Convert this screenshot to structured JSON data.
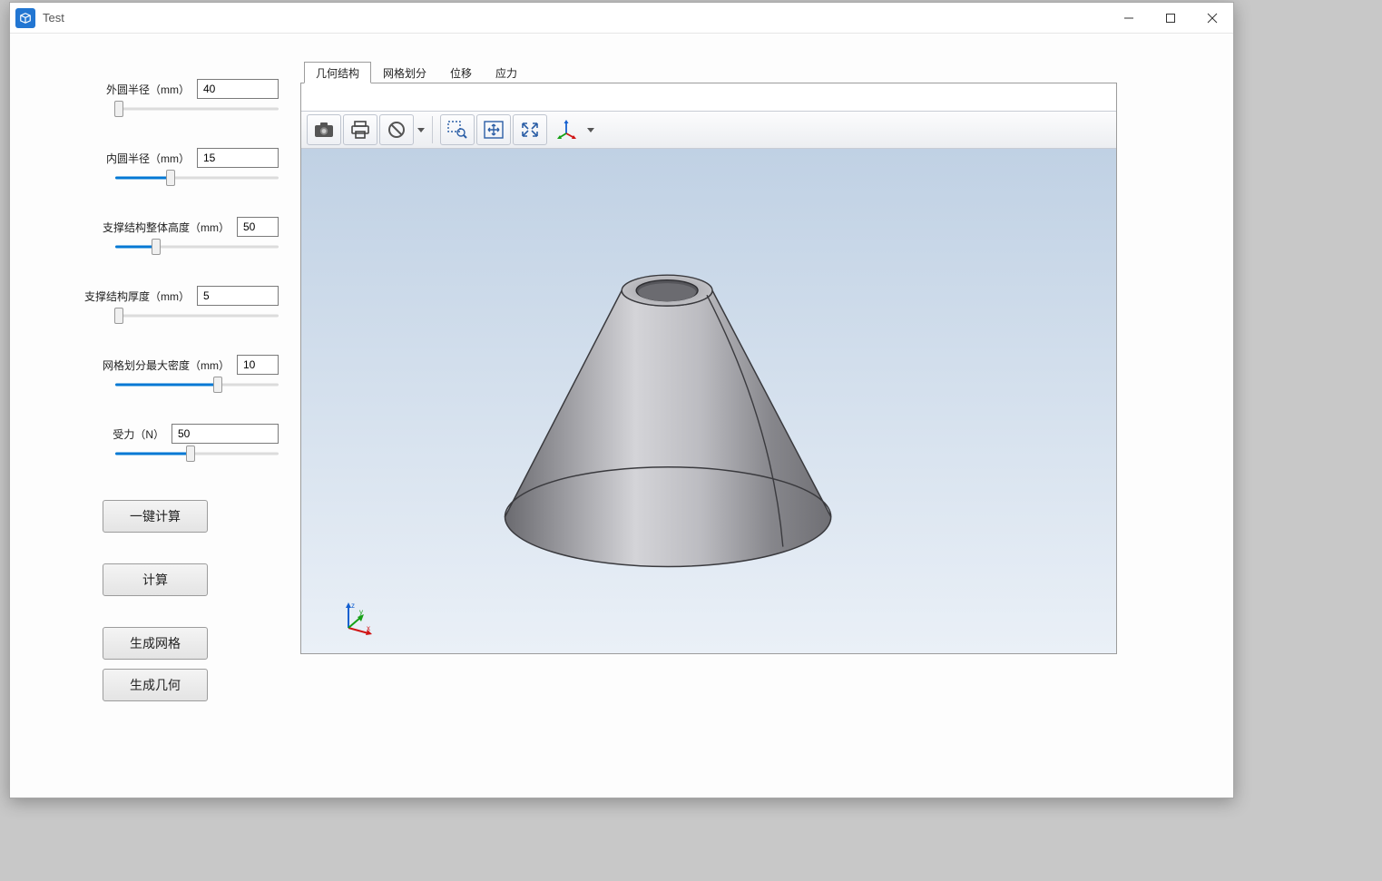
{
  "window": {
    "title": "Test"
  },
  "sidebar": {
    "params": [
      {
        "label": "外圆半径（mm）",
        "value": "40",
        "input_w": "w90",
        "fill_pct": 2
      },
      {
        "label": "内圆半径（mm）",
        "value": "15",
        "input_w": "w90",
        "fill_pct": 34
      },
      {
        "label": "支撑结构整体高度（mm）",
        "value": "50",
        "input_w": "w46",
        "fill_pct": 25
      },
      {
        "label": "支撑结构厚度（mm）",
        "value": "5",
        "input_w": "w90",
        "fill_pct": 2
      },
      {
        "label": "网格划分最大密度（mm）",
        "value": "10",
        "input_w": "w46",
        "fill_pct": 63
      },
      {
        "label": "受力（N）",
        "value": "50",
        "input_w": "w118",
        "fill_pct": 46
      }
    ],
    "buttons_primary": "一键计算",
    "buttons_secondary": [
      "计算",
      "生成网格",
      "生成几何"
    ]
  },
  "tabs": [
    {
      "label": "几何结构",
      "active": true
    },
    {
      "label": "网格划分",
      "active": false
    },
    {
      "label": "位移",
      "active": false
    },
    {
      "label": "应力",
      "active": false
    }
  ],
  "toolbar_icons": [
    "camera-icon",
    "print-icon",
    "forbidden-icon",
    "zoom-select-icon",
    "fit-view-icon",
    "reset-view-icon",
    "axes-icon"
  ],
  "axis_labels": {
    "x": "x",
    "y": "y",
    "z": "z"
  }
}
